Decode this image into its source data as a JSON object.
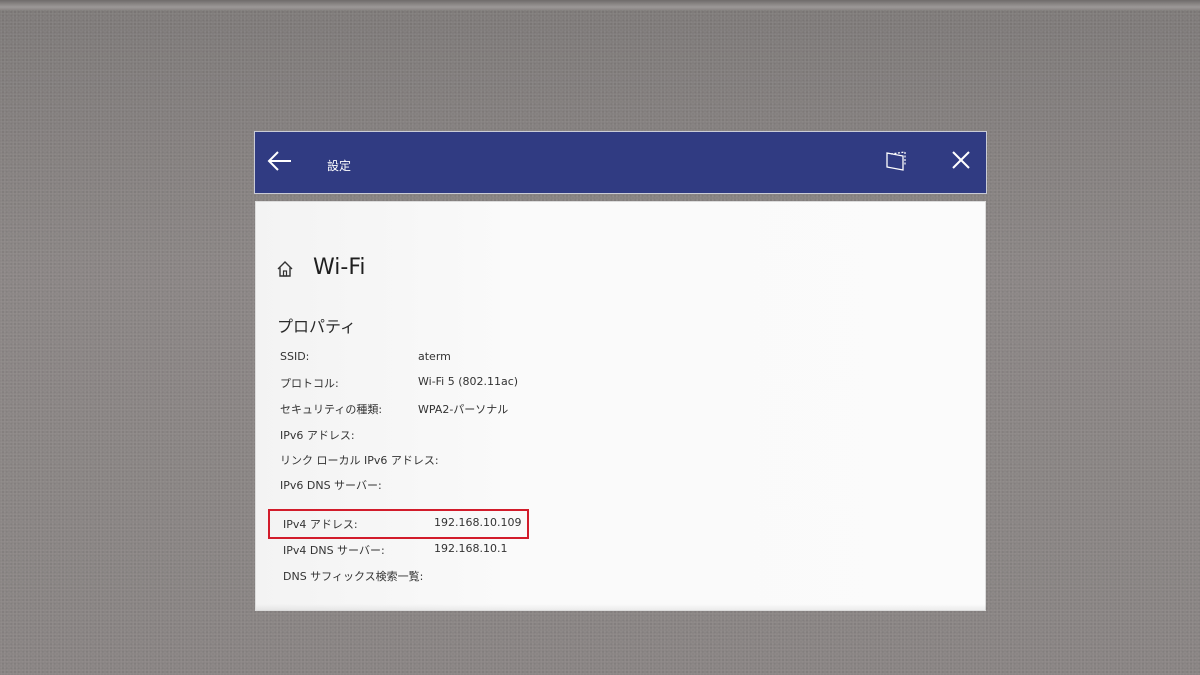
{
  "window": {
    "title": "設定",
    "back_icon": "back-arrow-icon",
    "snap_icon": "tablet-mode-icon",
    "close_icon": "close-icon",
    "header_color": "#303b82"
  },
  "page": {
    "home_icon": "home-icon",
    "title": "Wi-Fi",
    "section": "プロパティ"
  },
  "properties": [
    {
      "label": "SSID:",
      "value": "aterm"
    },
    {
      "label": "プロトコル:",
      "value": "Wi-Fi 5 (802.11ac)"
    },
    {
      "label": "セキュリティの種類:",
      "value": "WPA2-パーソナル"
    },
    {
      "label": "IPv6 アドレス:",
      "value": ""
    },
    {
      "label": "リンク ローカル IPv6 アドレス:",
      "value": ""
    },
    {
      "label": "IPv6 DNS サーバー:",
      "value": ""
    },
    {
      "label": "IPv4 アドレス:",
      "value": "192.168.10.109"
    },
    {
      "label": "IPv4 DNS サーバー:",
      "value": "192.168.10.1"
    },
    {
      "label": "DNS サフィックス検索一覧:",
      "value": ""
    }
  ],
  "highlight_color": "#d21c2b"
}
